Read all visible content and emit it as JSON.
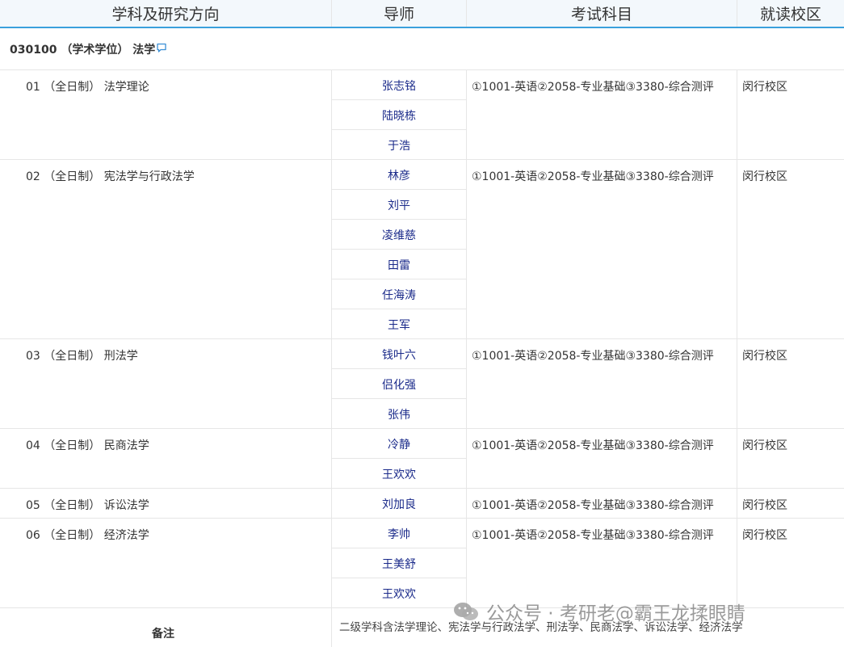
{
  "header": {
    "col_subject": "学科及研究方向",
    "col_tutor": "导师",
    "col_exam": "考试科目",
    "col_campus": "就读校区"
  },
  "section": {
    "title": "030100 （学术学位） 法学",
    "icon": "comment-icon"
  },
  "directions": [
    {
      "label": "01 （全日制） 法学理论",
      "tutors": [
        "张志铭",
        "陆晓栋",
        "于浩"
      ],
      "exam": "①1001-英语②2058-专业基础③3380-综合测评",
      "campus": "闵行校区"
    },
    {
      "label": "02 （全日制） 宪法学与行政法学",
      "tutors": [
        "林彦",
        "刘平",
        "凌维慈",
        "田雷",
        "任海涛",
        "王军"
      ],
      "exam": "①1001-英语②2058-专业基础③3380-综合测评",
      "campus": "闵行校区"
    },
    {
      "label": "03 （全日制） 刑法学",
      "tutors": [
        "钱叶六",
        "侣化强",
        "张伟"
      ],
      "exam": "①1001-英语②2058-专业基础③3380-综合测评",
      "campus": "闵行校区"
    },
    {
      "label": "04 （全日制） 民商法学",
      "tutors": [
        "冷静",
        "王欢欢"
      ],
      "exam": "①1001-英语②2058-专业基础③3380-综合测评",
      "campus": "闵行校区"
    },
    {
      "label": "05 （全日制） 诉讼法学",
      "tutors": [
        "刘加良"
      ],
      "exam": "①1001-英语②2058-专业基础③3380-综合测评",
      "campus": "闵行校区"
    },
    {
      "label": "06 （全日制） 经济法学",
      "tutors": [
        "李帅",
        "王美舒",
        "王欢欢"
      ],
      "exam": "①1001-英语②2058-专业基础③3380-综合测评",
      "campus": "闵行校区"
    }
  ],
  "remark": {
    "label": "备注",
    "text": "二级学科含法学理论、宪法学与行政法学、刑法学、民商法学、诉讼法学、经济法学"
  },
  "watermark": {
    "text": "公众号 · 考研老@霸王龙揉眼睛",
    "icon": "wechat-icon"
  }
}
